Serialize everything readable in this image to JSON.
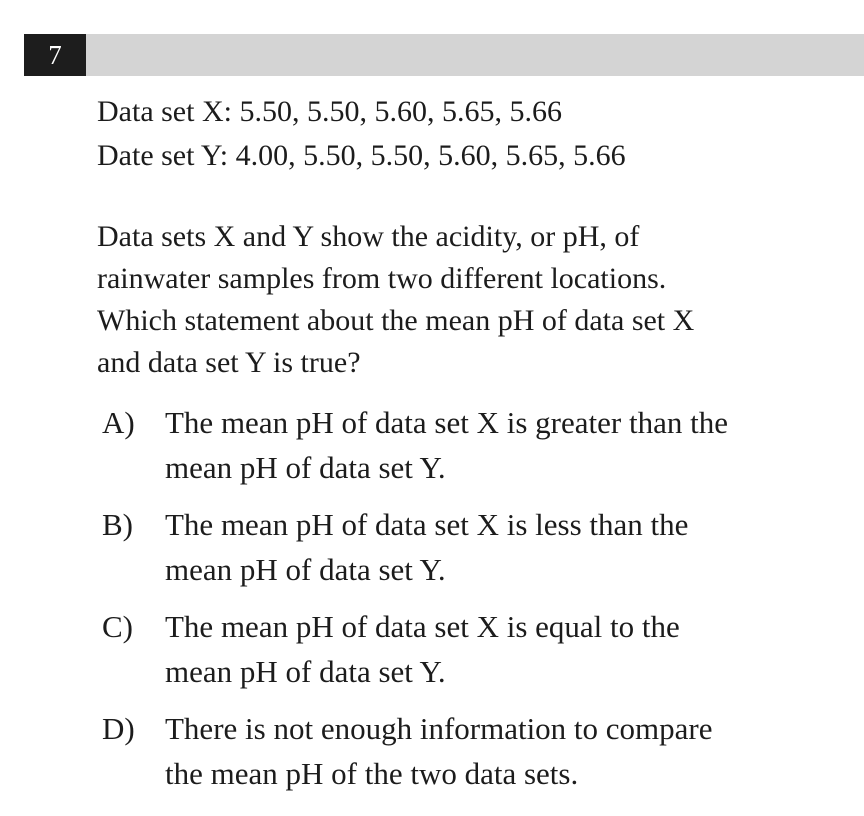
{
  "question": {
    "number": "7",
    "data_set_x": "Data set X: 5.50, 5.50, 5.60, 5.65, 5.66",
    "data_set_y": "Date set Y: 4.00, 5.50, 5.50, 5.60, 5.65, 5.66",
    "prompt_lines": [
      "Data sets X and Y show the acidity, or pH, of",
      "rainwater samples from two different locations.",
      "Which statement about the mean pH of data set X",
      "and data set Y is true?"
    ]
  },
  "choices": [
    {
      "letter": "A)",
      "lines": [
        "The mean pH of data set X is greater than the",
        "mean pH of data set Y."
      ]
    },
    {
      "letter": "B)",
      "lines": [
        "The mean pH of data set X is less than the",
        "mean pH of data set Y."
      ]
    },
    {
      "letter": "C)",
      "lines": [
        "The mean pH of data set X is equal to the",
        "mean pH of data set Y."
      ]
    },
    {
      "letter": "D)",
      "lines": [
        "There is not enough information to compare",
        "the mean pH of the two data sets."
      ]
    }
  ]
}
